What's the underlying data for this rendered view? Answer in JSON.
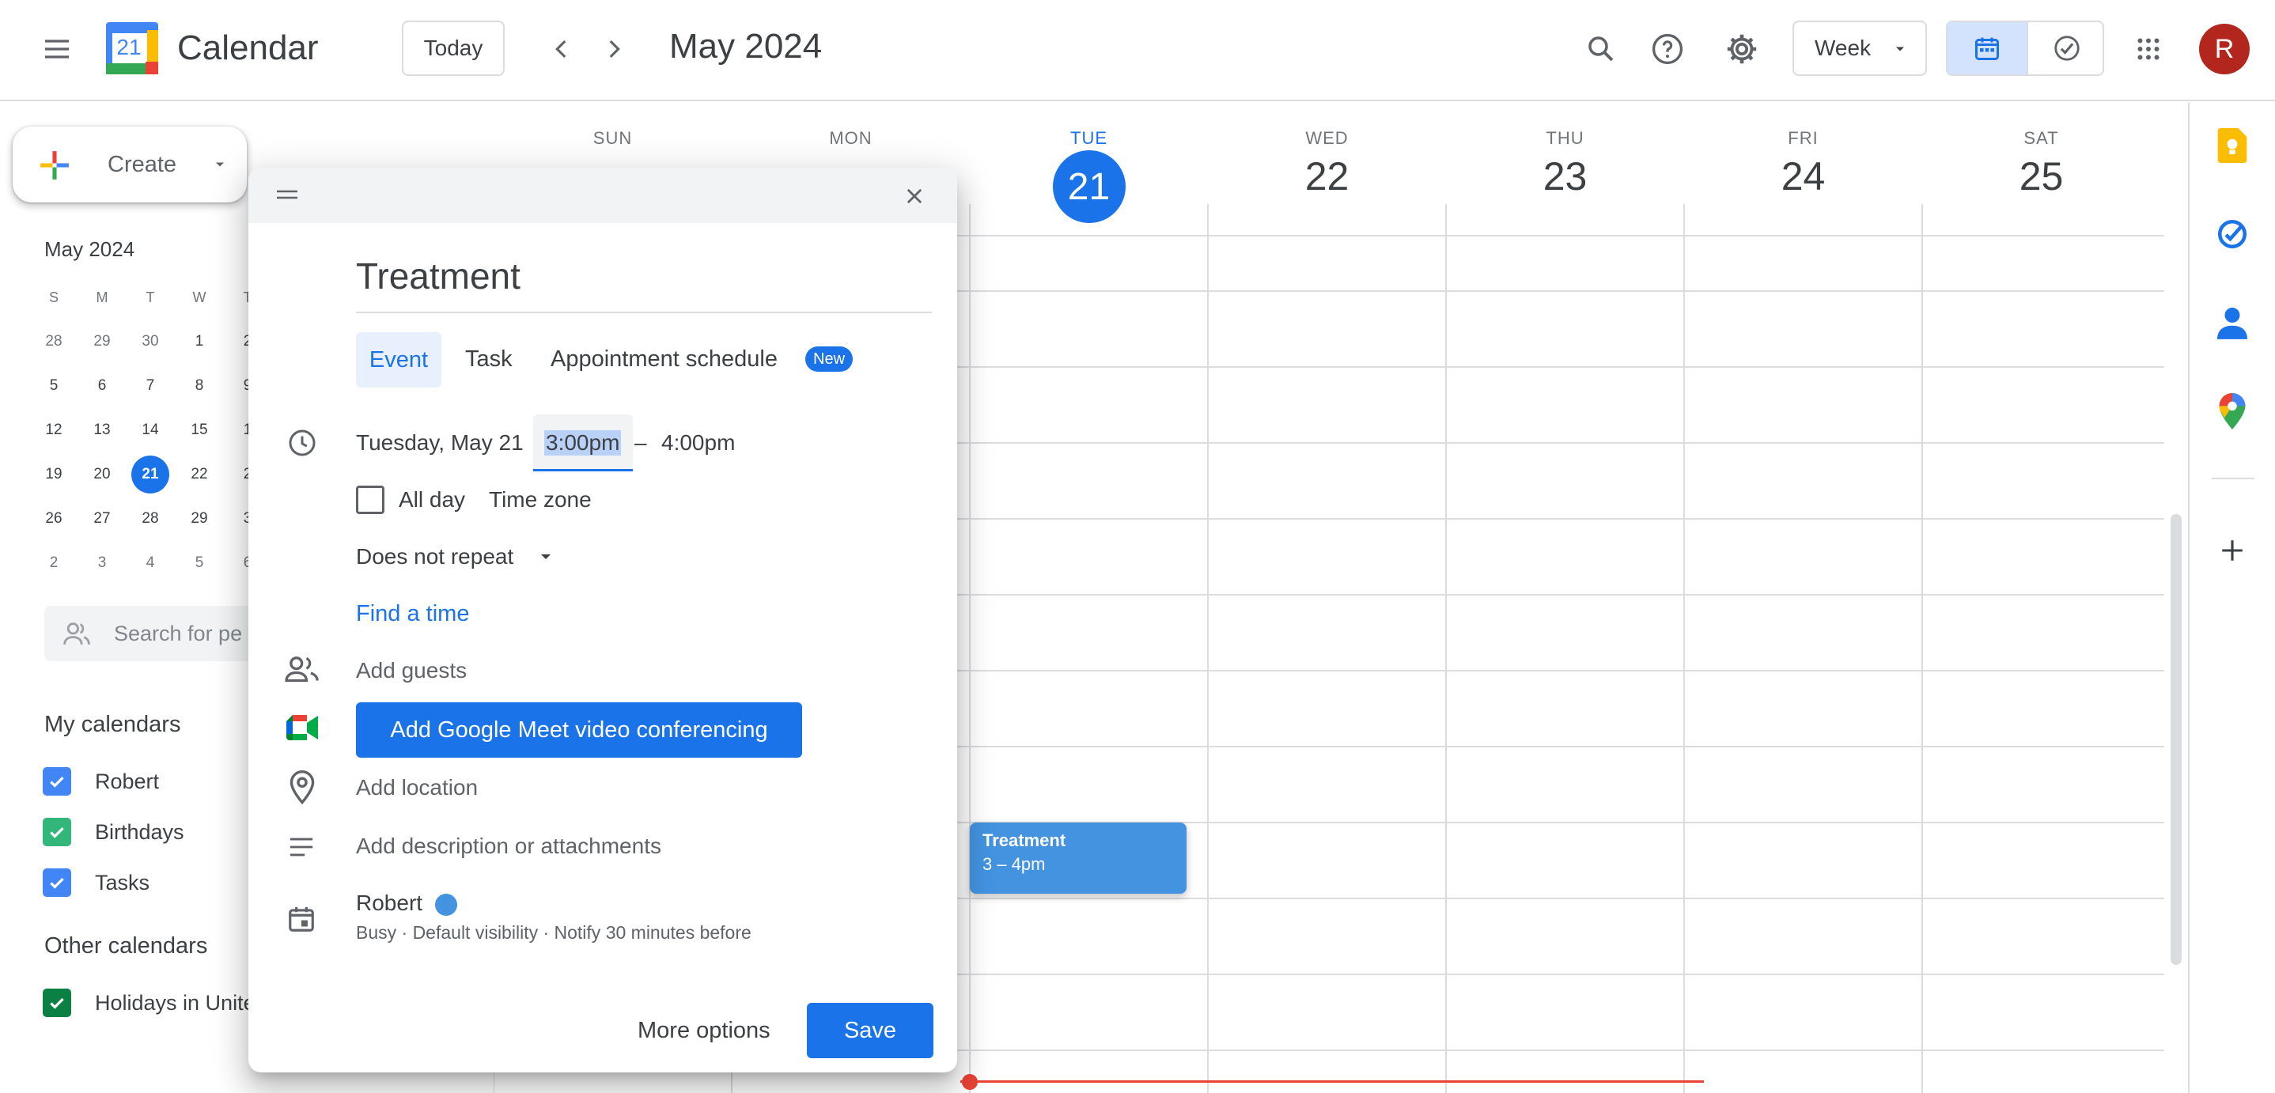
{
  "header": {
    "app_title": "Calendar",
    "logo_day": "21",
    "today_label": "Today",
    "month_title": "May 2024",
    "view_select": "Week",
    "avatar_letter": "R"
  },
  "sidebar": {
    "create_label": "Create",
    "mini_cal": {
      "title": "May 2024",
      "weekdays": [
        "S",
        "M",
        "T",
        "W",
        "T"
      ],
      "weeks": [
        [
          "28",
          "29",
          "30",
          "1",
          "2"
        ],
        [
          "5",
          "6",
          "7",
          "8",
          "9"
        ],
        [
          "12",
          "13",
          "14",
          "15",
          "1"
        ],
        [
          "19",
          "20",
          "21",
          "22",
          "2"
        ],
        [
          "26",
          "27",
          "28",
          "29",
          "3"
        ],
        [
          "2",
          "3",
          "4",
          "5",
          "6"
        ]
      ],
      "today": "21"
    },
    "search_people_placeholder": "Search for pe",
    "my_calendars_title": "My calendars",
    "my_calendars": [
      {
        "name": "Robert",
        "color": "#4285f4"
      },
      {
        "name": "Birthdays",
        "color": "#33b679"
      },
      {
        "name": "Tasks",
        "color": "#4285f4"
      }
    ],
    "other_calendars_title": "Other calendars",
    "other_calendars": [
      {
        "name": "Holidays in Unite",
        "color": "#0b8043"
      }
    ]
  },
  "week": {
    "days": [
      {
        "dow": "SUN",
        "num": ""
      },
      {
        "dow": "MON",
        "num": ""
      },
      {
        "dow": "TUE",
        "num": "21",
        "today": true
      },
      {
        "dow": "WED",
        "num": "22"
      },
      {
        "dow": "THU",
        "num": "23"
      },
      {
        "dow": "FRI",
        "num": "24"
      },
      {
        "dow": "SAT",
        "num": "25"
      }
    ],
    "event": {
      "title": "Treatment",
      "time": "3 – 4pm",
      "color": "#4393e0"
    }
  },
  "dialog": {
    "title_value": "Treatment",
    "tabs": {
      "event": "Event",
      "task": "Task",
      "appointment": "Appointment schedule",
      "new_badge": "New"
    },
    "date": "Tuesday, May 21",
    "start_time": "3:00pm",
    "dash": "–",
    "end_time": "4:00pm",
    "all_day": "All day",
    "time_zone": "Time zone",
    "repeat": "Does not repeat",
    "find_time": "Find a time",
    "add_guests": "Add guests",
    "meet_button": "Add Google Meet video conferencing",
    "add_location": "Add location",
    "add_description": "Add description or attachments",
    "calendar_name": "Robert",
    "calendar_details": "Busy · Default visibility · Notify 30 minutes before",
    "more_options": "More options",
    "save": "Save"
  },
  "colors": {
    "accent": "#1a73e8",
    "now_line": "#ea4335"
  }
}
